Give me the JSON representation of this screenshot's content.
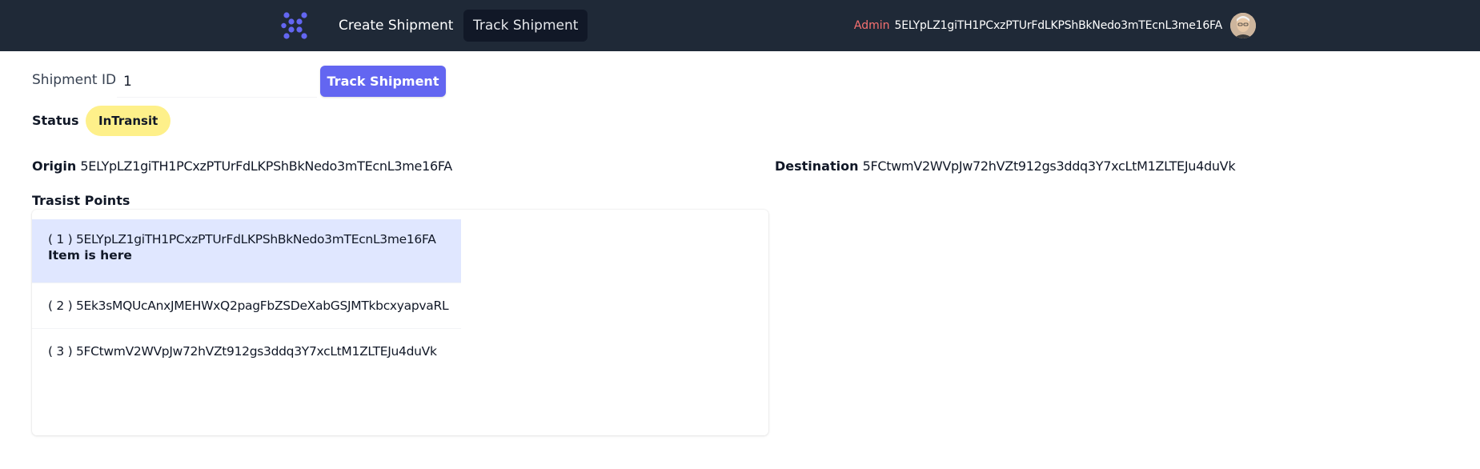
{
  "navbar": {
    "links": [
      {
        "label": "Create Shipment",
        "active": false
      },
      {
        "label": "Track Shipment",
        "active": true
      }
    ],
    "user": {
      "role": "Admin",
      "address": "5ELYpLZ1giTH1PCxzPTUrFdLKPShBkNedo3mTEcnL3me16FA"
    }
  },
  "tracker": {
    "shipment_id_label": "Shipment ID",
    "shipment_id_value": "1",
    "track_button_label": "Track Shipment"
  },
  "status": {
    "label": "Status",
    "value": "InTransit",
    "color": "#fef08a"
  },
  "origin": {
    "label": "Origin",
    "address": "5ELYpLZ1giTH1PCxzPTUrFdLKPShBkNedo3mTEcnL3me16FA"
  },
  "destination": {
    "label": "Destination",
    "address": "5FCtwmV2WVpJw72hVZt912gs3ddq3Y7xcLtM1ZLTEJu4duVk"
  },
  "transit": {
    "heading": "Trasist Points",
    "current_note": "Item is here",
    "points": [
      {
        "index": "( 1 )",
        "address": "5ELYpLZ1giTH1PCxzPTUrFdLKPShBkNedo3mTEcnL3me16FA",
        "current": true
      },
      {
        "index": "( 2 )",
        "address": "5Ek3sMQUcAnxJMEHWxQ2pagFbZSDeXabGSJMTkbcxyapvaRL",
        "current": false
      },
      {
        "index": "( 3 )",
        "address": "5FCtwmV2WVpJw72hVZt912gs3ddq3Y7xcLtM1ZLTEJu4duVk",
        "current": false
      }
    ]
  },
  "colors": {
    "navbar_bg": "#1f2937",
    "accent": "#6366f1",
    "role_text": "#f87171",
    "current_point_bg": "#e0e7ff"
  },
  "icons": {
    "logo": "app-logo-icon",
    "avatar": "user-avatar"
  }
}
